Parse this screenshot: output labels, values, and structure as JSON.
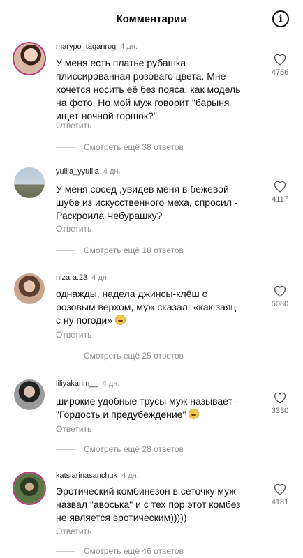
{
  "header": {
    "title": "Комментарии",
    "info_icon": "info-icon"
  },
  "comments": [
    {
      "username": "marypo_taganrog",
      "time": "4 дн.",
      "lines": [
        "У меня есть платье рубашка",
        "плиссированная розоваго цвета. Мне",
        "хочется носить её без пояса, как модель",
        "на фото. Но мой муж говорит \"барыня",
        "ищет ночной горшок?\""
      ],
      "reply_label": "Ответить",
      "likes": "4756",
      "more_replies": "Смотреть ещё 38 ответов",
      "avatar_color": "#c9a38a"
    },
    {
      "username": "yuliia_yyuliia",
      "time": "4 дн.",
      "lines": [
        "У меня сосед ,увидев меня в бежевой",
        "шубе из искусственного меха, спросил -",
        "Раскроила Чебурашку?"
      ],
      "reply_label": "Ответить",
      "likes": "4117",
      "more_replies": "Смотреть ещё 18 ответов",
      "avatar_color": "#9fb3c8"
    },
    {
      "username": "nizara.23",
      "time": "4 дн.",
      "lines": [
        "однажды, надела джинсы-клёш с",
        "розовым верхом, муж сказал: «как заяц",
        "с ну погоди»"
      ],
      "reply_label": "Ответить",
      "likes": "5080",
      "more_replies": "Смотреть ещё 25 ответов",
      "avatar_color": "#b08a74"
    },
    {
      "username": "liliyakarim__",
      "time": "4 дн.",
      "lines": [
        "широкие удобные трусы муж называет -",
        "\"Гордость и предубеждение\""
      ],
      "reply_label": "Ответить",
      "likes": "3330",
      "more_replies": "Смотреть ещё 28 ответов",
      "avatar_color": "#8a8a8a"
    },
    {
      "username": "katsiarinasanchuk",
      "time": "4 дн.",
      "lines": [
        "Эротический комбинезон в сеточку муж",
        "назвал \"авоська\" и с тех пор этот комбез",
        "не является эротическим)))))"
      ],
      "reply_label": "Ответить",
      "likes": "4181",
      "more_replies": "Смотреть ещё 46 ответов",
      "avatar_color": "#4f6b3e"
    }
  ]
}
